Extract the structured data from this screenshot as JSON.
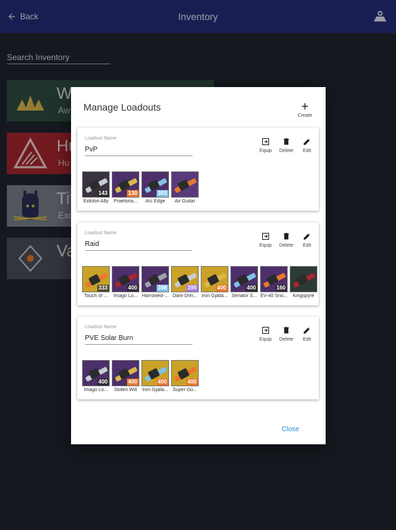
{
  "appbar": {
    "back_label": "Back",
    "title": "Inventory"
  },
  "search": {
    "placeholder": "Search Inventory"
  },
  "classes": [
    {
      "name": "W",
      "sub": "Aw"
    },
    {
      "name": "Hu",
      "sub": "Hu"
    },
    {
      "name": "Tit",
      "sub": "Exo"
    },
    {
      "name": "Va",
      "sub": ""
    }
  ],
  "dialog": {
    "title": "Manage Loadouts",
    "create_label": "Create",
    "close_label": "Close",
    "field_label": "Loadout Name",
    "actions": {
      "equip": "Equip",
      "delete": "Delete",
      "edit": "Edit"
    },
    "loadouts": [
      {
        "name": "PvP",
        "items": [
          {
            "name": "Eidolon Ally",
            "power": "143",
            "element": "void",
            "bg": "#3a3240"
          },
          {
            "name": "Praetoria...",
            "power": "130",
            "element": "solar",
            "bg": "#4d2f6b"
          },
          {
            "name": "Arc Edge",
            "power": "303",
            "element": "arc",
            "bg": "#4d2f6b"
          },
          {
            "name": "Air Guitar",
            "power": "",
            "element": "",
            "bg": "#5a3a7a"
          }
        ]
      },
      {
        "name": "Raid",
        "items": [
          {
            "name": "Touch of ...",
            "power": "333",
            "element": "void",
            "bg": "#c9a227"
          },
          {
            "name": "Imago Lo...",
            "power": "400",
            "element": "void",
            "bg": "#4d2f6b"
          },
          {
            "name": "Harrowed-...",
            "power": "398",
            "element": "arc",
            "bg": "#4d2f6b"
          },
          {
            "name": "Dark-Drin...",
            "power": "399",
            "element": "voidp",
            "bg": "#c9a227"
          },
          {
            "name": "Iron Gjalla...",
            "power": "400",
            "element": "solar",
            "bg": "#c9a227"
          },
          {
            "name": "Senator S...",
            "power": "400",
            "element": "void",
            "bg": "#4d2f6b"
          },
          {
            "name": "EV-40 Sno...",
            "power": "160",
            "element": "void",
            "bg": "#4d2f6b"
          },
          {
            "name": "Kingspyre",
            "power": "",
            "element": "",
            "bg": "#2c3a35"
          }
        ]
      },
      {
        "name": "PVE Solar Burn",
        "items": [
          {
            "name": "Imago Lo...",
            "power": "400",
            "element": "void",
            "bg": "#4d2f6b"
          },
          {
            "name": "Stolen Will",
            "power": "400",
            "element": "solar",
            "bg": "#4d2f6b"
          },
          {
            "name": "Iron Gjalla...",
            "power": "400",
            "element": "solar",
            "bg": "#c9a227"
          },
          {
            "name": "Super Go...",
            "power": "400",
            "element": "solar",
            "bg": "#c9a227"
          }
        ]
      }
    ]
  }
}
